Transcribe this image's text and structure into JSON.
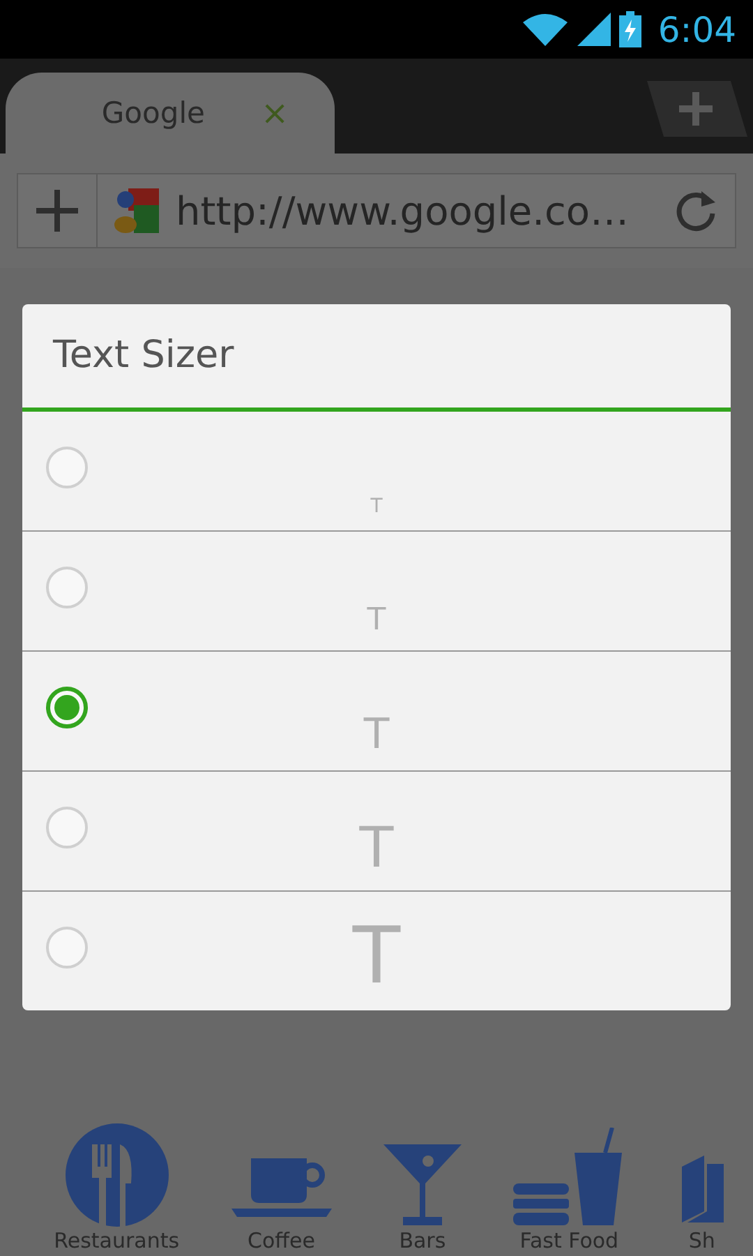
{
  "status_bar": {
    "time": "6:04"
  },
  "tabs": [
    {
      "title": "Google",
      "close": "×",
      "selected": true
    }
  ],
  "address_bar": {
    "url": "http://www.google.co…"
  },
  "dialog": {
    "title": "Text Sizer",
    "options": [
      {
        "label": "T",
        "selected": false
      },
      {
        "label": "T",
        "selected": false
      },
      {
        "label": "T",
        "selected": true
      },
      {
        "label": "T",
        "selected": false
      },
      {
        "label": "T",
        "selected": false
      }
    ]
  },
  "categories": [
    {
      "label": "Restaurants",
      "kind": "restaurant"
    },
    {
      "label": "Coffee",
      "kind": "coffee"
    },
    {
      "label": "Bars",
      "kind": "bar"
    },
    {
      "label": "Fast Food",
      "kind": "fastfood"
    },
    {
      "label": "Sh",
      "kind": "book"
    }
  ]
}
